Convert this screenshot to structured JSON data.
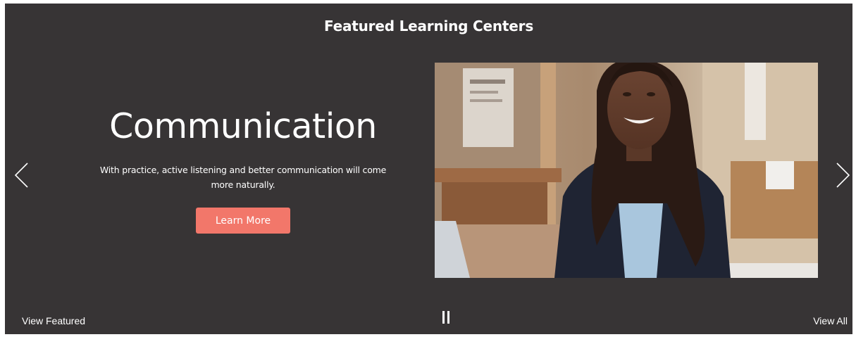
{
  "carousel": {
    "title": "Featured Learning Centers",
    "slide": {
      "heading": "Communication",
      "description": "With practice, active listening and better communication will come more naturally.",
      "button_label": "Learn More",
      "image_icon": "photo-woman-smiling-office"
    },
    "controls": {
      "prev_icon": "chevron-left-icon",
      "next_icon": "chevron-right-icon",
      "pause_icon": "pause-icon"
    },
    "footer": {
      "view_featured": "View Featured",
      "view_all": "View All"
    }
  },
  "colors": {
    "background": "#373435",
    "accent_button": "#f2776a",
    "text": "#ffffff"
  }
}
